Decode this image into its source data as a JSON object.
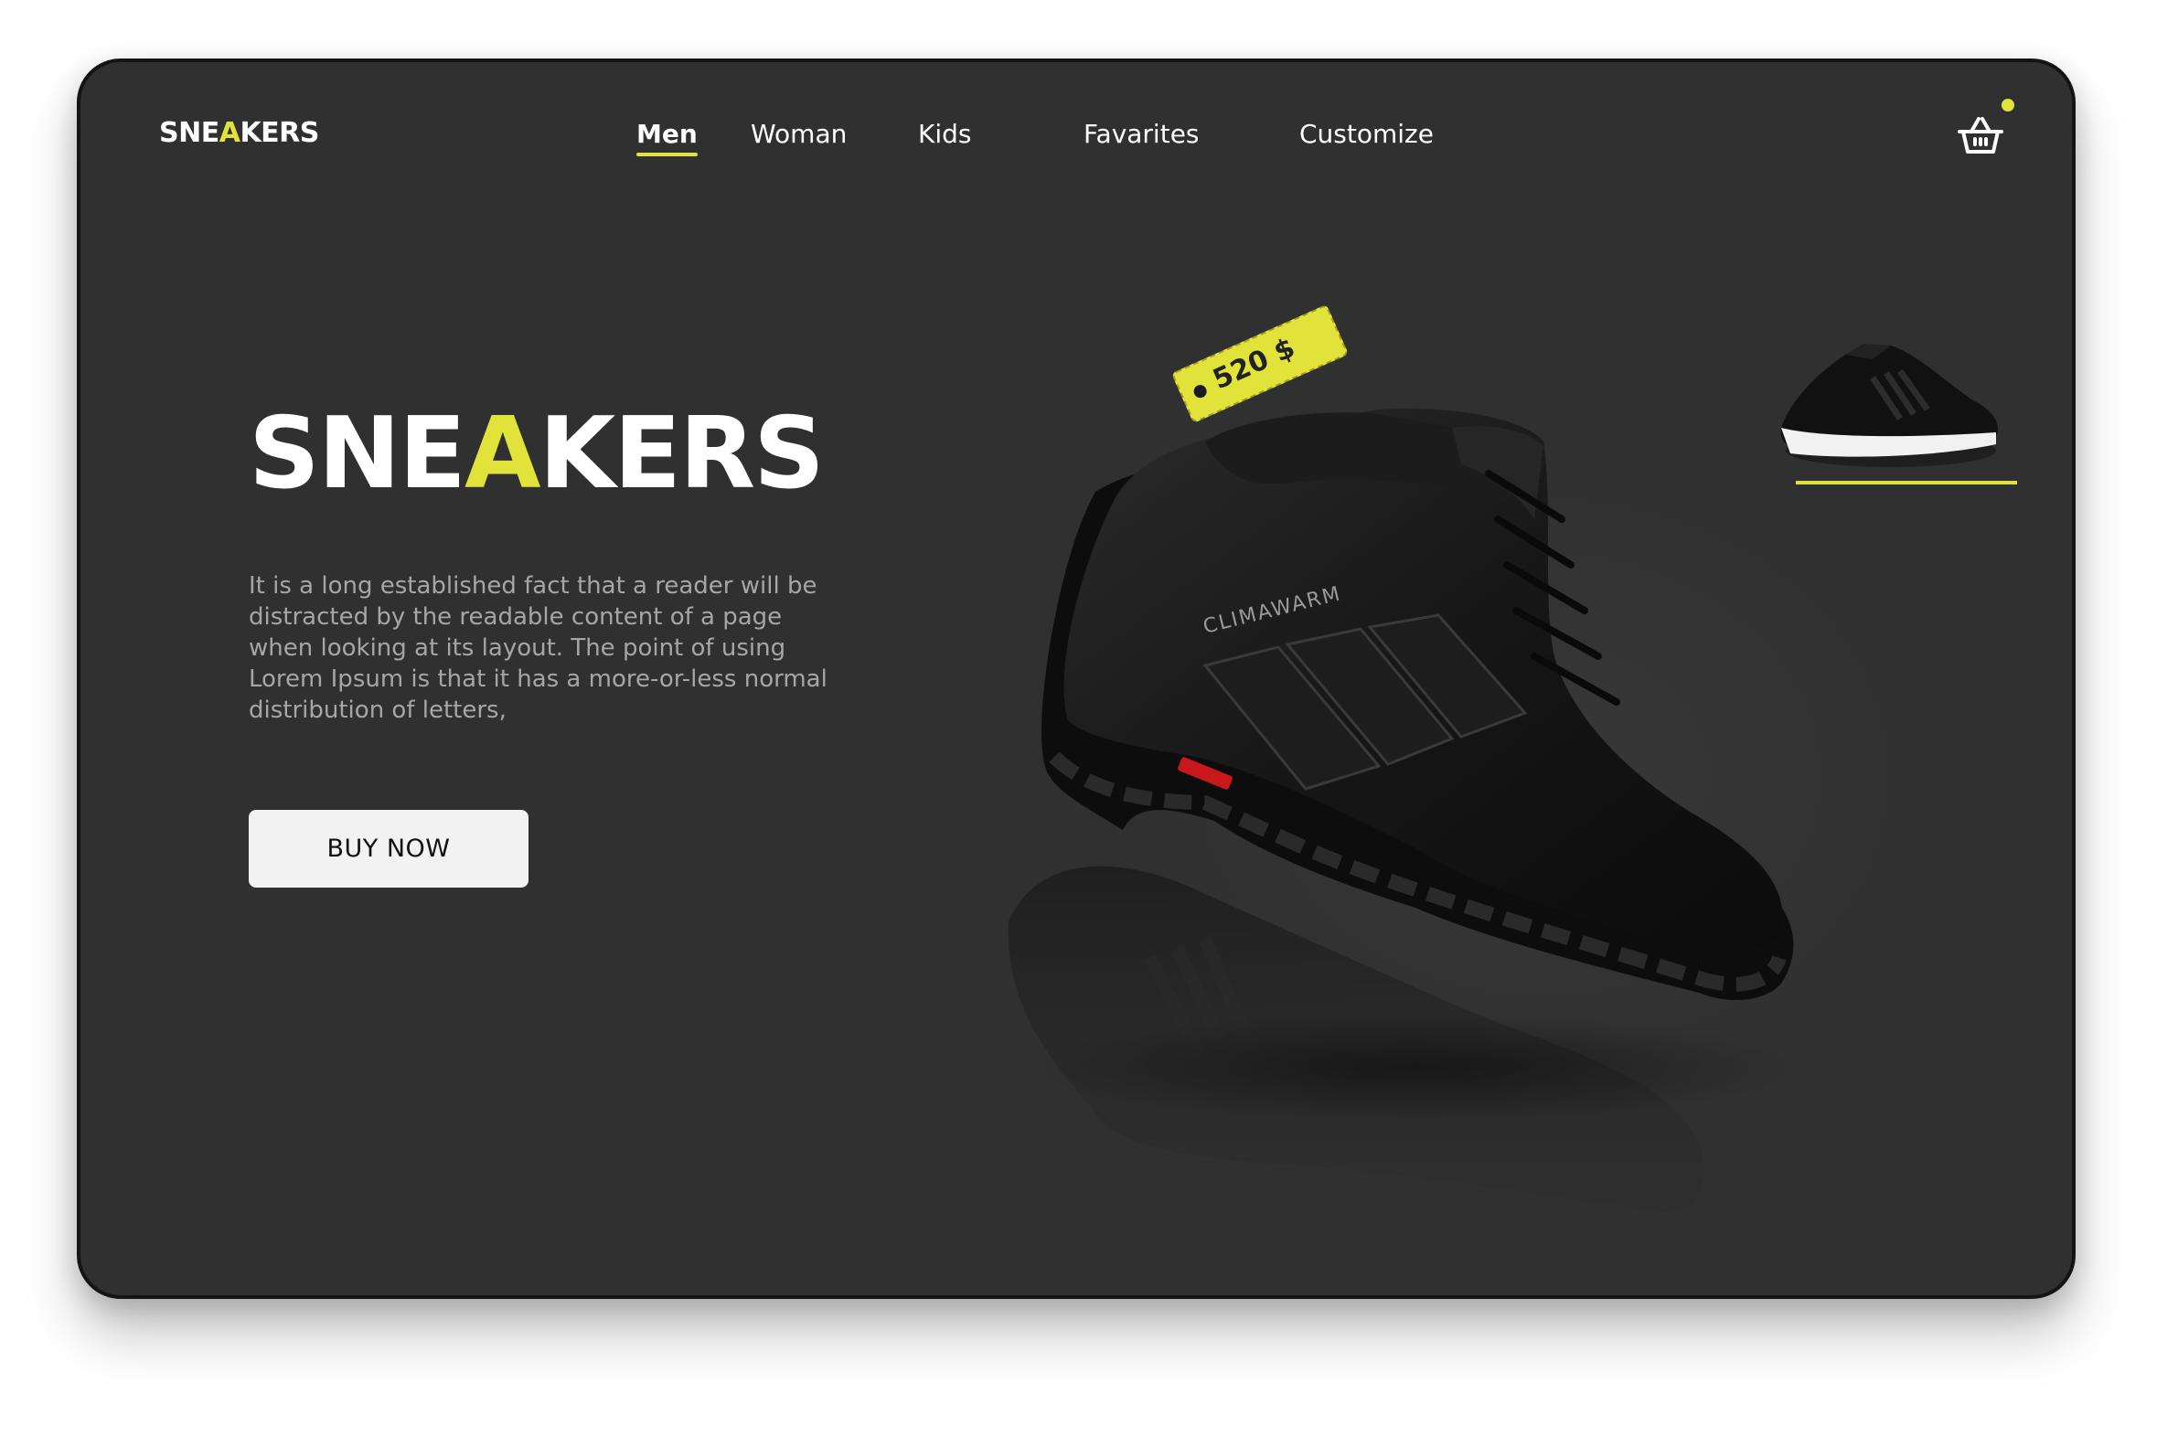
{
  "brand": {
    "logo_prefix": "SNE",
    "logo_accent": "A",
    "logo_suffix": "KERS",
    "accent_color": "#e1e23a"
  },
  "nav": {
    "items": [
      {
        "label": "Men",
        "active": true
      },
      {
        "label": "Woman",
        "active": false
      },
      {
        "label": "Kids",
        "active": false
      },
      {
        "label": "Favarites",
        "active": false
      },
      {
        "label": "Customize",
        "active": false
      }
    ]
  },
  "cart": {
    "icon": "basket-icon",
    "has_notification": true
  },
  "hero": {
    "title_prefix": "SNE",
    "title_accent": "A",
    "title_suffix": "KERS",
    "description": "It is a long established fact that a reader will be distracted by the readable content of a page when looking at its layout. The point of using Lorem Ipsum is that it has a more-or-less normal distribution of letters,",
    "cta_label": "BUY NOW"
  },
  "product": {
    "price": "520 $",
    "image": "black-high-top-sneaker-image",
    "shoe_brand_text": "CLIMAWARM"
  },
  "thumbnail": {
    "image": "black-running-sneaker-thumbnail",
    "selected": true
  },
  "colors": {
    "background": "#303030",
    "frame_border": "#141414",
    "button_bg": "#f2f2f2",
    "text_primary": "#ffffff",
    "text_muted": "#a6a6a6"
  }
}
